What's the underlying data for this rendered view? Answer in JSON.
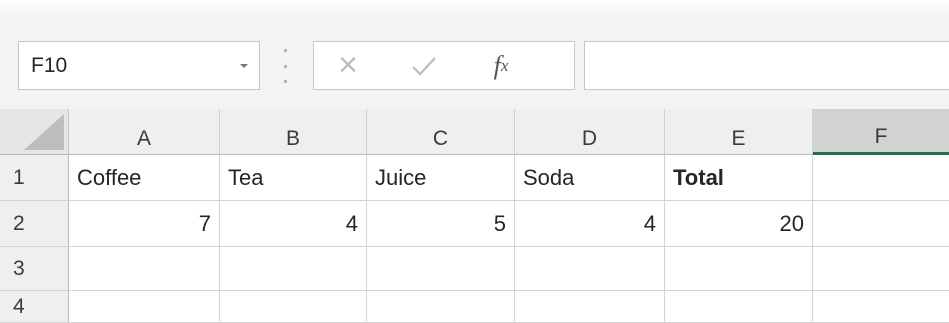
{
  "name_box": {
    "value": "F10",
    "dropdown_icon": "caret-down-icon"
  },
  "formula_bar": {
    "cancel_icon": "×",
    "enter_icon": "check-icon",
    "fx_label": "f",
    "fx_sub": "x",
    "formula_value": ""
  },
  "columns": [
    "A",
    "B",
    "C",
    "D",
    "E",
    "F"
  ],
  "selected_column": "F",
  "rows": [
    "1",
    "2",
    "3",
    "4"
  ],
  "cells": {
    "A1": "Coffee",
    "B1": "Tea",
    "C1": "Juice",
    "D1": "Soda",
    "E1": "Total",
    "F1": "",
    "A2": "7",
    "B2": "4",
    "C2": "5",
    "D2": "4",
    "E2": "20",
    "F2": "",
    "A3": "",
    "B3": "",
    "C3": "",
    "D3": "",
    "E3": "",
    "F3": "",
    "A4": "",
    "B4": "",
    "C4": "",
    "D4": "",
    "E4": "",
    "F4": ""
  },
  "colors": {
    "selection_accent": "#217346",
    "header_bg": "#efefef",
    "gridline": "#d4d4d4"
  }
}
